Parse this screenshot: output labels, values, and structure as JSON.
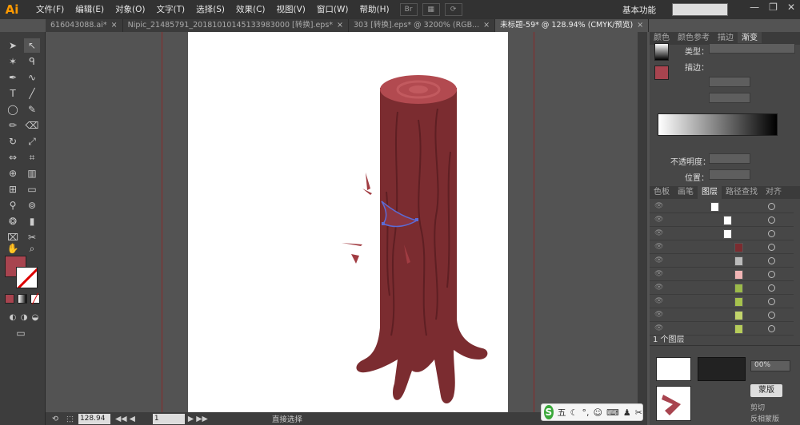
{
  "app": {
    "logo": "Ai"
  },
  "menu": [
    "文件(F)",
    "编辑(E)",
    "对象(O)",
    "文字(T)",
    "选择(S)",
    "效果(C)",
    "视图(V)",
    "窗口(W)",
    "帮助(H)"
  ],
  "bridge_label": "Br",
  "workspace": "基本功能",
  "tabs": [
    {
      "label": "616043088.ai*",
      "active": false
    },
    {
      "label": "Nipic_21485791_20181010145133983000 [转换].eps*",
      "active": false
    },
    {
      "label": "303 [转换].eps* @ 3200% (RGB...",
      "active": false
    },
    {
      "label": "未标题-59* @ 128.94% (CMYK/预览)",
      "active": true
    }
  ],
  "status": {
    "zoom": "128.94",
    "page": "1",
    "tool": "直接选择"
  },
  "ime": {
    "logo": "S",
    "mode": "五"
  },
  "panels": {
    "top_tabs": [
      "颜色",
      "颜色参考",
      "描边",
      "渐变"
    ],
    "gradient": {
      "type_label": "类型：",
      "stroke_label": "描边：",
      "opacity_label": "不透明度：",
      "position_label": "位置："
    },
    "layer_tabs": [
      "色板",
      "画笔",
      "图层",
      "路径查找",
      "对齐"
    ],
    "layers_count": "1 个图层",
    "lower": {
      "label_a": "剪切",
      "label_b": "反相蒙版",
      "button": "蒙版",
      "percent": "00%"
    }
  },
  "colors": {
    "fill": "#a8444f",
    "trunk": "#7b2c30",
    "trunk_dark": "#5e1f23",
    "top": "#b24a50",
    "top_ring": "#c25a5f",
    "leaf": "#a13c42"
  }
}
